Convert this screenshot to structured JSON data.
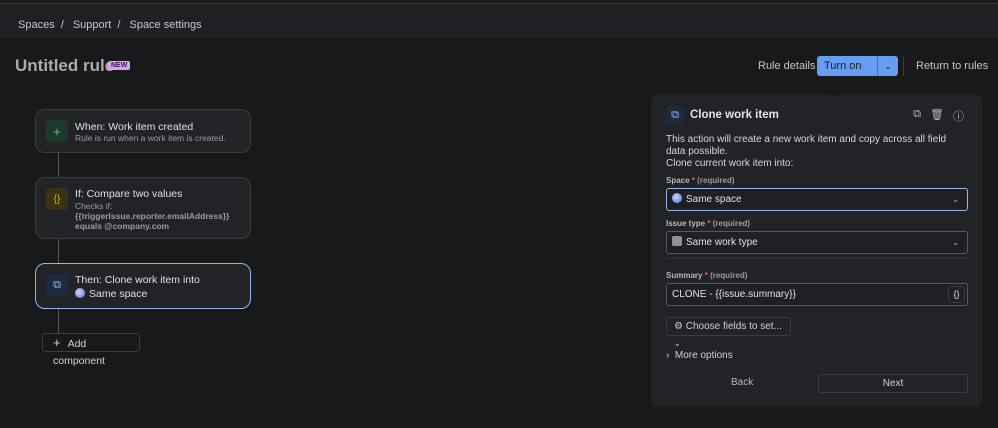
{
  "breadcrumb": [
    "Spaces",
    "Support",
    "Space settings"
  ],
  "header": {
    "title": "Untitled rule",
    "badge": "NEW",
    "rule_details": "Rule details",
    "turn_on": "Turn on rule",
    "return": "Return to rules"
  },
  "flow": {
    "trigger": {
      "title": "When: Work item created",
      "subtitle": "Rule is run when a work item is created."
    },
    "condition": {
      "title": "If: Compare two values",
      "line1": "Checks if:",
      "line2": "{{triggerIssue.reporter.emailAddress}}",
      "line3": "equals @company.com"
    },
    "action": {
      "title": "Then: Clone work item into",
      "value": "Same space"
    },
    "add_component": "Add component"
  },
  "panel": {
    "title": "Clone work item",
    "desc1": "This action will create a new work item and copy across all field data possible.",
    "desc2": "Clone current work item into:",
    "space_label": "Space",
    "space_value": "Same space",
    "issue_type_label": "Issue type",
    "issue_type_value": "Same work type",
    "summary_label": "Summary",
    "summary_value": "CLONE - {{issue.summary}}",
    "required": "(required)",
    "required_mark": "*",
    "choose_fields": "Choose fields to set...",
    "more_options": "More options",
    "back": "Back",
    "next": "Next"
  }
}
